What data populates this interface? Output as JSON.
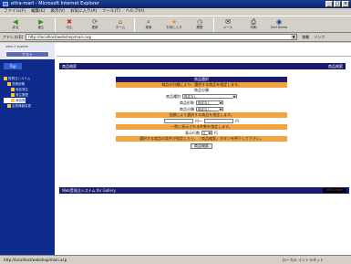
{
  "window": {
    "title": "eitra-mart - Microsoft Internet Explorer",
    "min": "_",
    "max": "□",
    "close": "×"
  },
  "menu": [
    "ファイル(F)",
    "編集(E)",
    "表示(V)",
    "お気に入り(A)",
    "ツール(T)",
    "ヘルプ(H)"
  ],
  "toolbar": [
    {
      "label": "戻る",
      "icon": "back-icon",
      "glyph": "◀"
    },
    {
      "label": "進む",
      "icon": "forward-icon",
      "glyph": "▶"
    },
    {
      "label": "中止",
      "icon": "stop-icon",
      "glyph": "✖"
    },
    {
      "label": "更新",
      "icon": "refresh-icon",
      "glyph": "⟳"
    },
    {
      "label": "ホーム",
      "icon": "home-icon",
      "glyph": "⌂"
    },
    {
      "label": "検索",
      "icon": "search-icon",
      "glyph": "⌕"
    },
    {
      "label": "お気に入り",
      "icon": "favorites-icon",
      "glyph": "★"
    },
    {
      "label": "履歴",
      "icon": "history-icon",
      "glyph": "◷"
    },
    {
      "label": "メール",
      "icon": "mail-icon",
      "glyph": "✉"
    },
    {
      "label": "印刷",
      "icon": "print-icon",
      "glyph": "⎙"
    },
    {
      "label": "Dell Home",
      "icon": "dell-icon",
      "glyph": "◉"
    }
  ],
  "address": {
    "label": "アドレス(D)",
    "value": "http://localhost/webshop/main.asp",
    "go": "移動",
    "links": "リンク"
  },
  "left": {
    "tab": "view 2 system",
    "button": "ゲスト",
    "topic": "Top",
    "tree": [
      {
        "label": "受発注システム",
        "active": false
      },
      {
        "label": "見積依頼",
        "active": false
      },
      {
        "label": "商品発注",
        "active": false
      },
      {
        "label": "発注履歴",
        "active": false
      },
      {
        "label": "商品照会",
        "active": true
      },
      {
        "label": "会員情報変更",
        "active": false
      }
    ]
  },
  "page": {
    "header_left": "商品検索",
    "header_right": "商品検索",
    "section_title": "商品選択",
    "instruction1": "商品の分類により、選択する商品を指定します。",
    "category_title": "商品分類",
    "fields": [
      {
        "label": "商品種別",
        "value": "指定なし"
      },
      {
        "label": "商品形態",
        "value": "指定なし"
      },
      {
        "label": "商品分類",
        "value": "指定なし"
      }
    ],
    "instruction2": "金額により選択する商品を指定します。",
    "price_unit1": "円～",
    "price_unit2": "円",
    "instruction3": "一覧に表示される件数を指定します。",
    "count_label": "表示行数",
    "count_value": "5",
    "count_unit": "行",
    "instruction4": "選択する商品の条件が指定したら、『商品検索』ボタンを押下して下さい。",
    "search_button": "商品検索",
    "footer": "Web受発注システム for Gallery",
    "footer_logo": "eitra-mart"
  },
  "status": {
    "left": "http://localhost/webshop/main.asp",
    "right": "ローカル イントラネット"
  }
}
